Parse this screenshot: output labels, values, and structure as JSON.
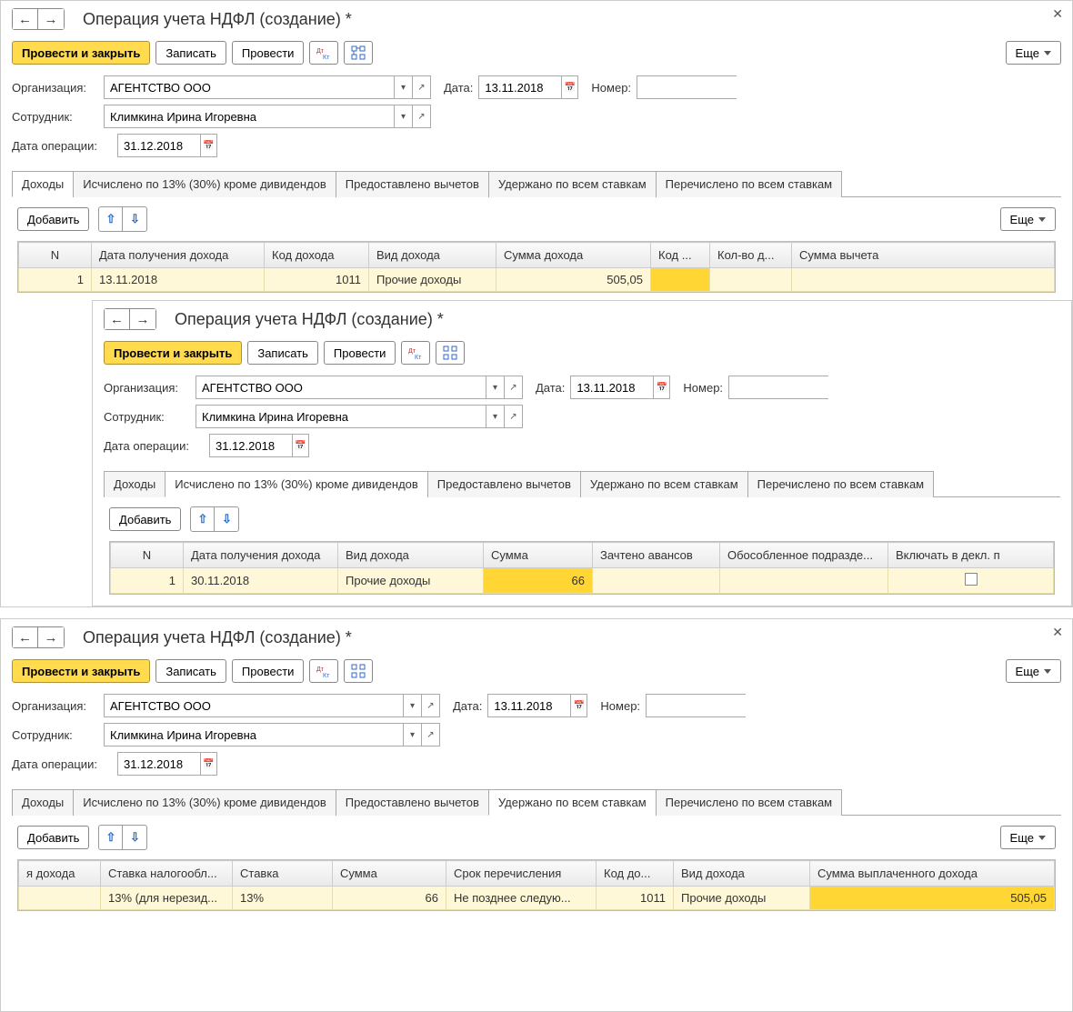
{
  "common": {
    "title": "Операция учета НДФЛ (создание) *",
    "toolbar": {
      "primary": "Провести и закрыть",
      "save": "Записать",
      "post": "Провести",
      "more": "Еще"
    },
    "labels": {
      "org": "Организация:",
      "emp": "Сотрудник:",
      "date": "Дата:",
      "num": "Номер:",
      "op_date": "Дата операции:",
      "add": "Добавить"
    },
    "values": {
      "org": "АГЕНТСТВО ООО",
      "emp": "Климкина Ирина Игоревна",
      "date": "13.11.2018",
      "num": "",
      "op_date": "31.12.2018"
    },
    "tabnames": {
      "t0": "Доходы",
      "t1": "Исчислено по 13% (30%) кроме дивидендов",
      "t2": "Предоставлено вычетов",
      "t3": "Удержано по всем ставкам",
      "t4": "Перечислено по всем ставкам"
    }
  },
  "panel1": {
    "active_tab": 0,
    "headers": {
      "n": "N",
      "c1": "Дата получения дохода",
      "c2": "Код дохода",
      "c3": "Вид дохода",
      "c4": "Сумма дохода",
      "c5": "Код ...",
      "c6": "Кол-во д...",
      "c7": "Сумма вычета"
    },
    "row": {
      "n": "1",
      "date": "13.11.2018",
      "code": "1011",
      "kind": "Прочие доходы",
      "sum": "505,05"
    }
  },
  "panel2": {
    "active_tab": 1,
    "headers": {
      "n": "N",
      "c1": "Дата получения дохода",
      "c2": "Вид дохода",
      "c3": "Сумма",
      "c4": "Зачтено авансов",
      "c5": "Обособленное подразде...",
      "c6": "Включать в декл. п"
    },
    "row": {
      "n": "1",
      "date": "30.11.2018",
      "kind": "Прочие доходы",
      "sum": "66"
    }
  },
  "panel3": {
    "active_tab": 3,
    "headers": {
      "c0": "я дохода",
      "c1": "Ставка налогообл...",
      "c2": "Ставка",
      "c3": "Сумма",
      "c4": "Срок перечисления",
      "c5": "Код до...",
      "c6": "Вид дохода",
      "c7": "Сумма выплаченного дохода"
    },
    "row": {
      "rate_cat": "13% (для нерезид...",
      "rate": "13%",
      "sum": "66",
      "deadline": "Не позднее следую...",
      "code": "1011",
      "kind": "Прочие доходы",
      "paid": "505,05"
    }
  }
}
